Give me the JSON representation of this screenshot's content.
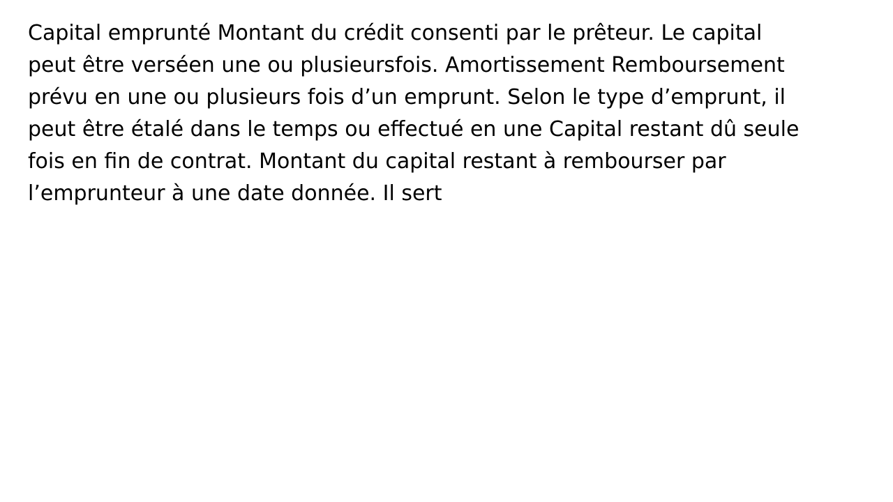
{
  "slide": {
    "lines": [
      "Capital emprunté Montant du crédit consenti par le prêteur. Le capital",
      "peut être verséen une ou plusieursfois. Amortissement Remboursement",
      "prévu en une ou plusieurs fois d’un emprunt. Selon le type d’emprunt, il",
      "peut être étalé dans le temps ou effectué en une Capital restant dû seule",
      "fois en fin de contrat. Montant du capital restant à rembourser par",
      "l’emprunteur à une date donnée. Il sert"
    ]
  }
}
